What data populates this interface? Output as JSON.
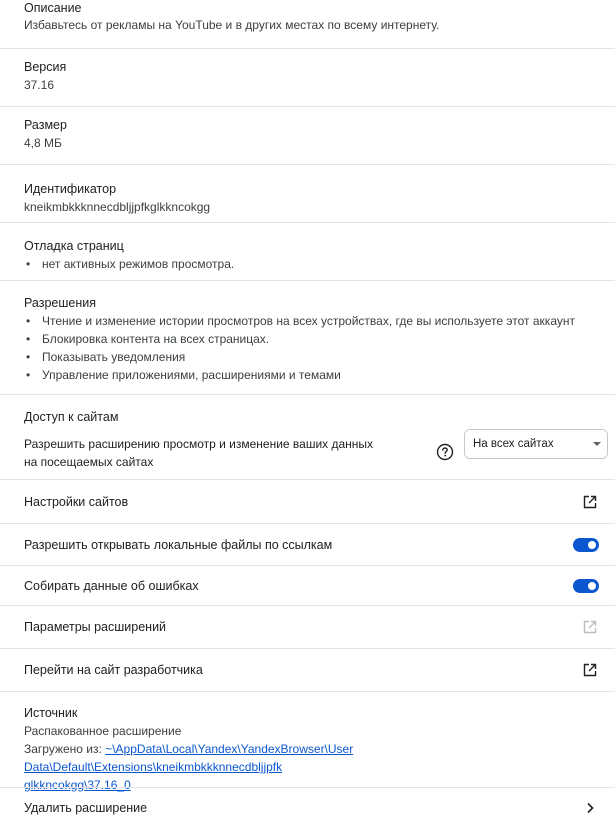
{
  "description": {
    "label": "Описание",
    "text": "Избавьтесь от рекламы на YouTube и в других местах по всему интернету."
  },
  "version": {
    "label": "Версия",
    "value": "37.16"
  },
  "size": {
    "label": "Размер",
    "value": "4,8 МБ"
  },
  "identifier": {
    "label": "Идентификатор",
    "value": "kneikmbkkknnecdbljjpfkglkkncokgg"
  },
  "debug": {
    "label": "Отладка страниц",
    "items": [
      "нет активных режимов просмотра."
    ]
  },
  "permissions": {
    "label": "Разрешения",
    "items": [
      "Чтение и изменение истории просмотров на всех устройствах, где вы используете этот аккаунт",
      "Блокировка контента на всех страницах.",
      "Показывать уведомления",
      "Управление приложениями, расширениями и темами"
    ]
  },
  "site_access": {
    "label": "Доступ к сайтам",
    "desc_line1": "Разрешить расширению просмотр и изменение ваших данных",
    "desc_line2": "на посещаемых сайтах",
    "help_icon": "help-circle-icon",
    "select_value": "На всех сайтах"
  },
  "site_settings": {
    "label": "Настройки сайтов",
    "icon": "open-in-new-icon"
  },
  "local_files": {
    "label": "Разрешить открывать локальные файлы по ссылкам",
    "enabled": true
  },
  "collect_errors": {
    "label": "Собирать данные об ошибках",
    "enabled": true
  },
  "ext_options": {
    "label": "Параметры расширений",
    "icon": "open-in-new-icon",
    "disabled": true
  },
  "dev_site": {
    "label": "Перейти на сайт разработчика",
    "icon": "open-in-new-icon"
  },
  "source": {
    "label": "Источник",
    "type": "Распакованное расширение",
    "loaded_prefix": "Загружено из:",
    "path_line1": "~\\AppData\\Local\\Yandex\\YandexBrowser\\User Data\\Default\\Extensions\\kneikmbkkknnecdbljjpfk",
    "path_line2": "glkkncokgg\\37.16_0"
  },
  "remove": {
    "label": "Удалить расширение",
    "icon": "chevron-right-icon"
  },
  "colors": {
    "accent": "#0b57d0",
    "divider": "#e3e3e3",
    "text": "#202124"
  }
}
